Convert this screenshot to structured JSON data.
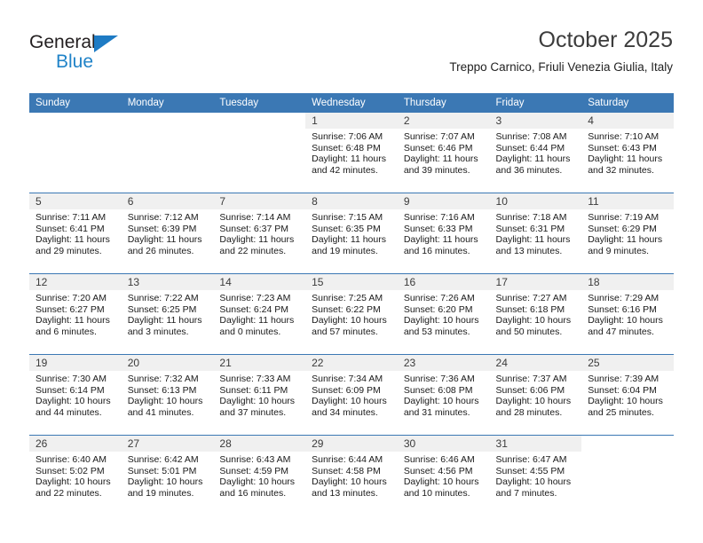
{
  "brand": {
    "name_part1": "General",
    "name_part2": "Blue",
    "triangle_color": "#1e7bc4",
    "blue_color": "#2083c8"
  },
  "header": {
    "month_title": "October 2025",
    "location": "Treppo Carnico, Friuli Venezia Giulia, Italy"
  },
  "theme": {
    "header_blue": "#3b78b4",
    "daynum_band": "#f0f0f0",
    "text": "#1a1a1a"
  },
  "weekdays": [
    "Sunday",
    "Monday",
    "Tuesday",
    "Wednesday",
    "Thursday",
    "Friday",
    "Saturday"
  ],
  "weeks": [
    [
      {
        "day": "",
        "sunrise": "",
        "sunset": "",
        "daylight1": "",
        "daylight2": ""
      },
      {
        "day": "",
        "sunrise": "",
        "sunset": "",
        "daylight1": "",
        "daylight2": ""
      },
      {
        "day": "",
        "sunrise": "",
        "sunset": "",
        "daylight1": "",
        "daylight2": ""
      },
      {
        "day": "1",
        "sunrise": "Sunrise: 7:06 AM",
        "sunset": "Sunset: 6:48 PM",
        "daylight1": "Daylight: 11 hours",
        "daylight2": "and 42 minutes."
      },
      {
        "day": "2",
        "sunrise": "Sunrise: 7:07 AM",
        "sunset": "Sunset: 6:46 PM",
        "daylight1": "Daylight: 11 hours",
        "daylight2": "and 39 minutes."
      },
      {
        "day": "3",
        "sunrise": "Sunrise: 7:08 AM",
        "sunset": "Sunset: 6:44 PM",
        "daylight1": "Daylight: 11 hours",
        "daylight2": "and 36 minutes."
      },
      {
        "day": "4",
        "sunrise": "Sunrise: 7:10 AM",
        "sunset": "Sunset: 6:43 PM",
        "daylight1": "Daylight: 11 hours",
        "daylight2": "and 32 minutes."
      }
    ],
    [
      {
        "day": "5",
        "sunrise": "Sunrise: 7:11 AM",
        "sunset": "Sunset: 6:41 PM",
        "daylight1": "Daylight: 11 hours",
        "daylight2": "and 29 minutes."
      },
      {
        "day": "6",
        "sunrise": "Sunrise: 7:12 AM",
        "sunset": "Sunset: 6:39 PM",
        "daylight1": "Daylight: 11 hours",
        "daylight2": "and 26 minutes."
      },
      {
        "day": "7",
        "sunrise": "Sunrise: 7:14 AM",
        "sunset": "Sunset: 6:37 PM",
        "daylight1": "Daylight: 11 hours",
        "daylight2": "and 22 minutes."
      },
      {
        "day": "8",
        "sunrise": "Sunrise: 7:15 AM",
        "sunset": "Sunset: 6:35 PM",
        "daylight1": "Daylight: 11 hours",
        "daylight2": "and 19 minutes."
      },
      {
        "day": "9",
        "sunrise": "Sunrise: 7:16 AM",
        "sunset": "Sunset: 6:33 PM",
        "daylight1": "Daylight: 11 hours",
        "daylight2": "and 16 minutes."
      },
      {
        "day": "10",
        "sunrise": "Sunrise: 7:18 AM",
        "sunset": "Sunset: 6:31 PM",
        "daylight1": "Daylight: 11 hours",
        "daylight2": "and 13 minutes."
      },
      {
        "day": "11",
        "sunrise": "Sunrise: 7:19 AM",
        "sunset": "Sunset: 6:29 PM",
        "daylight1": "Daylight: 11 hours",
        "daylight2": "and 9 minutes."
      }
    ],
    [
      {
        "day": "12",
        "sunrise": "Sunrise: 7:20 AM",
        "sunset": "Sunset: 6:27 PM",
        "daylight1": "Daylight: 11 hours",
        "daylight2": "and 6 minutes."
      },
      {
        "day": "13",
        "sunrise": "Sunrise: 7:22 AM",
        "sunset": "Sunset: 6:25 PM",
        "daylight1": "Daylight: 11 hours",
        "daylight2": "and 3 minutes."
      },
      {
        "day": "14",
        "sunrise": "Sunrise: 7:23 AM",
        "sunset": "Sunset: 6:24 PM",
        "daylight1": "Daylight: 11 hours",
        "daylight2": "and 0 minutes."
      },
      {
        "day": "15",
        "sunrise": "Sunrise: 7:25 AM",
        "sunset": "Sunset: 6:22 PM",
        "daylight1": "Daylight: 10 hours",
        "daylight2": "and 57 minutes."
      },
      {
        "day": "16",
        "sunrise": "Sunrise: 7:26 AM",
        "sunset": "Sunset: 6:20 PM",
        "daylight1": "Daylight: 10 hours",
        "daylight2": "and 53 minutes."
      },
      {
        "day": "17",
        "sunrise": "Sunrise: 7:27 AM",
        "sunset": "Sunset: 6:18 PM",
        "daylight1": "Daylight: 10 hours",
        "daylight2": "and 50 minutes."
      },
      {
        "day": "18",
        "sunrise": "Sunrise: 7:29 AM",
        "sunset": "Sunset: 6:16 PM",
        "daylight1": "Daylight: 10 hours",
        "daylight2": "and 47 minutes."
      }
    ],
    [
      {
        "day": "19",
        "sunrise": "Sunrise: 7:30 AM",
        "sunset": "Sunset: 6:14 PM",
        "daylight1": "Daylight: 10 hours",
        "daylight2": "and 44 minutes."
      },
      {
        "day": "20",
        "sunrise": "Sunrise: 7:32 AM",
        "sunset": "Sunset: 6:13 PM",
        "daylight1": "Daylight: 10 hours",
        "daylight2": "and 41 minutes."
      },
      {
        "day": "21",
        "sunrise": "Sunrise: 7:33 AM",
        "sunset": "Sunset: 6:11 PM",
        "daylight1": "Daylight: 10 hours",
        "daylight2": "and 37 minutes."
      },
      {
        "day": "22",
        "sunrise": "Sunrise: 7:34 AM",
        "sunset": "Sunset: 6:09 PM",
        "daylight1": "Daylight: 10 hours",
        "daylight2": "and 34 minutes."
      },
      {
        "day": "23",
        "sunrise": "Sunrise: 7:36 AM",
        "sunset": "Sunset: 6:08 PM",
        "daylight1": "Daylight: 10 hours",
        "daylight2": "and 31 minutes."
      },
      {
        "day": "24",
        "sunrise": "Sunrise: 7:37 AM",
        "sunset": "Sunset: 6:06 PM",
        "daylight1": "Daylight: 10 hours",
        "daylight2": "and 28 minutes."
      },
      {
        "day": "25",
        "sunrise": "Sunrise: 7:39 AM",
        "sunset": "Sunset: 6:04 PM",
        "daylight1": "Daylight: 10 hours",
        "daylight2": "and 25 minutes."
      }
    ],
    [
      {
        "day": "26",
        "sunrise": "Sunrise: 6:40 AM",
        "sunset": "Sunset: 5:02 PM",
        "daylight1": "Daylight: 10 hours",
        "daylight2": "and 22 minutes."
      },
      {
        "day": "27",
        "sunrise": "Sunrise: 6:42 AM",
        "sunset": "Sunset: 5:01 PM",
        "daylight1": "Daylight: 10 hours",
        "daylight2": "and 19 minutes."
      },
      {
        "day": "28",
        "sunrise": "Sunrise: 6:43 AM",
        "sunset": "Sunset: 4:59 PM",
        "daylight1": "Daylight: 10 hours",
        "daylight2": "and 16 minutes."
      },
      {
        "day": "29",
        "sunrise": "Sunrise: 6:44 AM",
        "sunset": "Sunset: 4:58 PM",
        "daylight1": "Daylight: 10 hours",
        "daylight2": "and 13 minutes."
      },
      {
        "day": "30",
        "sunrise": "Sunrise: 6:46 AM",
        "sunset": "Sunset: 4:56 PM",
        "daylight1": "Daylight: 10 hours",
        "daylight2": "and 10 minutes."
      },
      {
        "day": "31",
        "sunrise": "Sunrise: 6:47 AM",
        "sunset": "Sunset: 4:55 PM",
        "daylight1": "Daylight: 10 hours",
        "daylight2": "and 7 minutes."
      },
      {
        "day": "",
        "sunrise": "",
        "sunset": "",
        "daylight1": "",
        "daylight2": ""
      }
    ]
  ]
}
